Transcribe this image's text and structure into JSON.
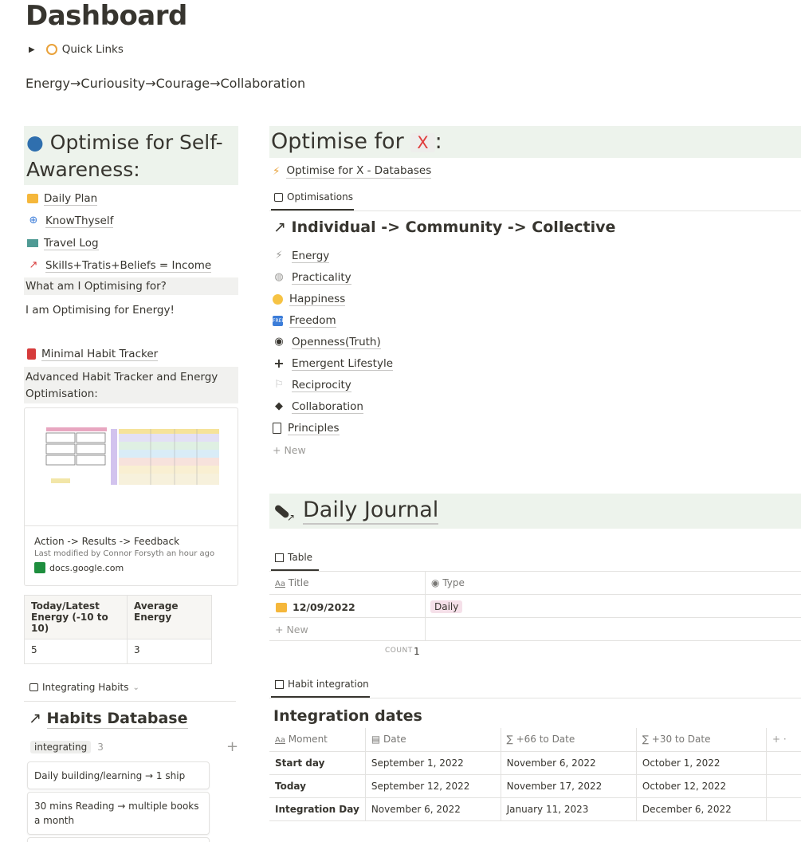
{
  "page": {
    "title": "Dashboard",
    "quick_links": "Quick Links",
    "motto": "Energy→Curiousity→Courage→Collaboration"
  },
  "left": {
    "heading": "Optimise for Self-Awareness:",
    "links": [
      {
        "label": "Daily Plan",
        "icon": "sunrise-icon"
      },
      {
        "label": "KnowThyself",
        "icon": "globe-icon"
      },
      {
        "label": "Travel Log",
        "icon": "map-icon"
      },
      {
        "label": "Skills+Tratis+Beliefs = Income",
        "icon": "chart-up-icon"
      }
    ],
    "question": "What am I Optimising for?",
    "answer": "I am Optimising for Energy!",
    "habit_tracker": "Minimal Habit Tracker",
    "advanced": "Advanced Habit Tracker and Energy Optimisation:",
    "bookmark": {
      "title": "Action -> Results -> Feedback",
      "modified": "Last modified by Connor Forsyth an hour ago",
      "domain": "docs.google.com"
    },
    "energy_table": {
      "headers": [
        "Today/Latest Energy (-10 to 10)",
        "Average Energy"
      ],
      "row": [
        "5",
        "3"
      ]
    },
    "habits_view": "Integrating Habits",
    "habits_db": "Habits Database",
    "group": {
      "label": "integrating",
      "count": "3"
    },
    "cards": [
      "Daily building/learning → 1 ship",
      "30 mins Reading → multiple books a month"
    ]
  },
  "right": {
    "opt_title_prefix": "Optimise for",
    "opt_title_x": "X",
    "opt_title_suffix": ":",
    "opt_db_link": "Optimise for X - Databases",
    "opt_tab": "Optimisations",
    "ind_heading": "Individual -> Community -> Collective",
    "items": [
      {
        "label": "Energy",
        "icon": "energy-icon"
      },
      {
        "label": "Practicality",
        "icon": "cycle-icon"
      },
      {
        "label": "Happiness",
        "icon": "grin-icon"
      },
      {
        "label": "Freedom",
        "icon": "free-icon"
      },
      {
        "label": "Openness(Truth)",
        "icon": "eye-icon"
      },
      {
        "label": "Emergent Lifestyle",
        "icon": "plus-icon"
      },
      {
        "label": "Reciprocity",
        "icon": "flag-icon"
      },
      {
        "label": "Collaboration",
        "icon": "graduation-cap-icon"
      },
      {
        "label": "Principles",
        "icon": "document-icon"
      }
    ],
    "new_label": "+ New",
    "journal_title": "Daily Journal",
    "journal_tab": "Table",
    "journal_columns": [
      "Title",
      "Type"
    ],
    "journal_rows": [
      {
        "title": "12/09/2022",
        "type": "Daily"
      }
    ],
    "journal_count_label": "COUNT",
    "journal_count": "1",
    "hi_tab": "Habit integration",
    "int_title": "Integration dates",
    "int_columns": [
      "Moment",
      "Date",
      "+66 to Date",
      "+30 to Date"
    ],
    "int_rows": [
      [
        "Start day",
        "September 1, 2022",
        "November 6, 2022",
        "October 1, 2022"
      ],
      [
        "Today",
        "September 12, 2022",
        "November 17, 2022",
        "October 12, 2022"
      ],
      [
        "Integration Day",
        "November 6, 2022",
        "January 11, 2023",
        "December 6, 2022"
      ]
    ]
  }
}
